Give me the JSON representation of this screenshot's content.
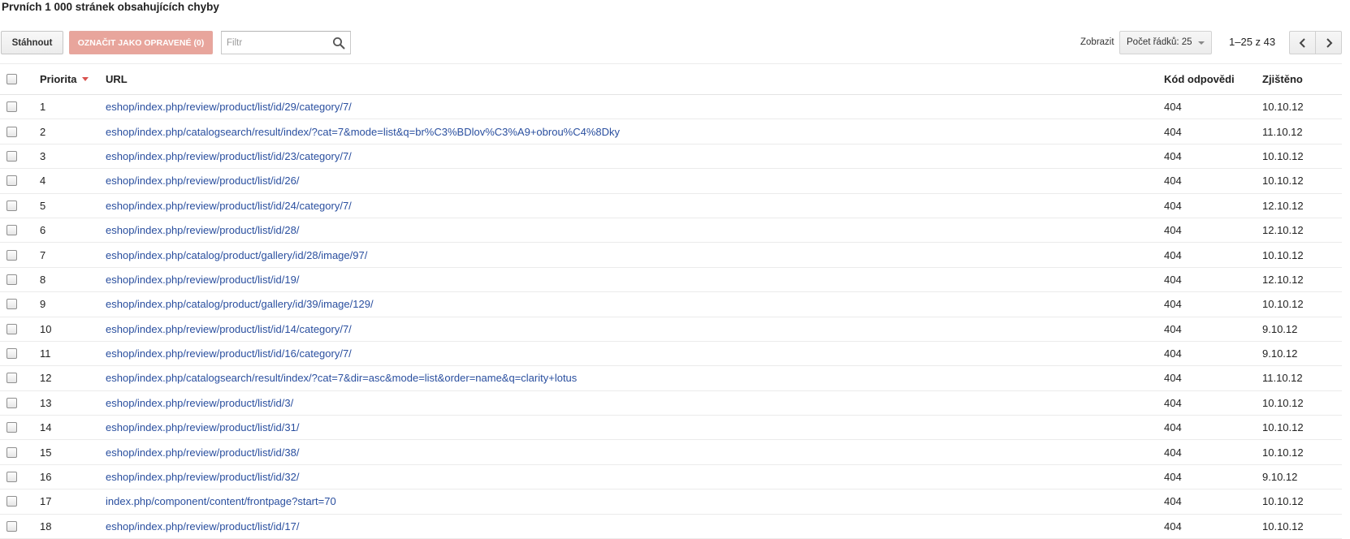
{
  "page": {
    "title": "Prvních 1 000 stránek obsahujících chyby"
  },
  "toolbar": {
    "download_label": "Stáhnout",
    "mark_fixed_label": "OZNAČIT JAKO OPRAVENÉ (0)",
    "filter_placeholder": "Filtr",
    "show_label": "Zobrazit",
    "rows_select_label": "Počet řádků: 25",
    "range_label": "1–25 z 43"
  },
  "colors": {
    "link": "#2a4f9f",
    "mark_button_bg": "#e8a59c",
    "sort_header": "#c0392b"
  },
  "table": {
    "headers": {
      "priority": "Priorita",
      "url": "URL",
      "code": "Kód odpovědi",
      "detected": "Zjištěno"
    },
    "rows": [
      {
        "priority": "1",
        "url": "eshop/index.php/review/product/list/id/29/category/7/",
        "code": "404",
        "date": "10.10.12"
      },
      {
        "priority": "2",
        "url": "eshop/index.php/catalogsearch/result/index/?cat=7&mode=list&q=br%C3%BDlov%C3%A9+obrou%C4%8Dky",
        "code": "404",
        "date": "11.10.12"
      },
      {
        "priority": "3",
        "url": "eshop/index.php/review/product/list/id/23/category/7/",
        "code": "404",
        "date": "10.10.12"
      },
      {
        "priority": "4",
        "url": "eshop/index.php/review/product/list/id/26/",
        "code": "404",
        "date": "10.10.12"
      },
      {
        "priority": "5",
        "url": "eshop/index.php/review/product/list/id/24/category/7/",
        "code": "404",
        "date": "12.10.12"
      },
      {
        "priority": "6",
        "url": "eshop/index.php/review/product/list/id/28/",
        "code": "404",
        "date": "12.10.12"
      },
      {
        "priority": "7",
        "url": "eshop/index.php/catalog/product/gallery/id/28/image/97/",
        "code": "404",
        "date": "10.10.12"
      },
      {
        "priority": "8",
        "url": "eshop/index.php/review/product/list/id/19/",
        "code": "404",
        "date": "12.10.12"
      },
      {
        "priority": "9",
        "url": "eshop/index.php/catalog/product/gallery/id/39/image/129/",
        "code": "404",
        "date": "10.10.12"
      },
      {
        "priority": "10",
        "url": "eshop/index.php/review/product/list/id/14/category/7/",
        "code": "404",
        "date": "9.10.12"
      },
      {
        "priority": "11",
        "url": "eshop/index.php/review/product/list/id/16/category/7/",
        "code": "404",
        "date": "9.10.12"
      },
      {
        "priority": "12",
        "url": "eshop/index.php/catalogsearch/result/index/?cat=7&dir=asc&mode=list&order=name&q=clarity+lotus",
        "code": "404",
        "date": "11.10.12"
      },
      {
        "priority": "13",
        "url": "eshop/index.php/review/product/list/id/3/",
        "code": "404",
        "date": "10.10.12"
      },
      {
        "priority": "14",
        "url": "eshop/index.php/review/product/list/id/31/",
        "code": "404",
        "date": "10.10.12"
      },
      {
        "priority": "15",
        "url": "eshop/index.php/review/product/list/id/38/",
        "code": "404",
        "date": "10.10.12"
      },
      {
        "priority": "16",
        "url": "eshop/index.php/review/product/list/id/32/",
        "code": "404",
        "date": "9.10.12"
      },
      {
        "priority": "17",
        "url": "index.php/component/content/frontpage?start=70",
        "code": "404",
        "date": "10.10.12"
      },
      {
        "priority": "18",
        "url": "eshop/index.php/review/product/list/id/17/",
        "code": "404",
        "date": "10.10.12"
      }
    ]
  }
}
